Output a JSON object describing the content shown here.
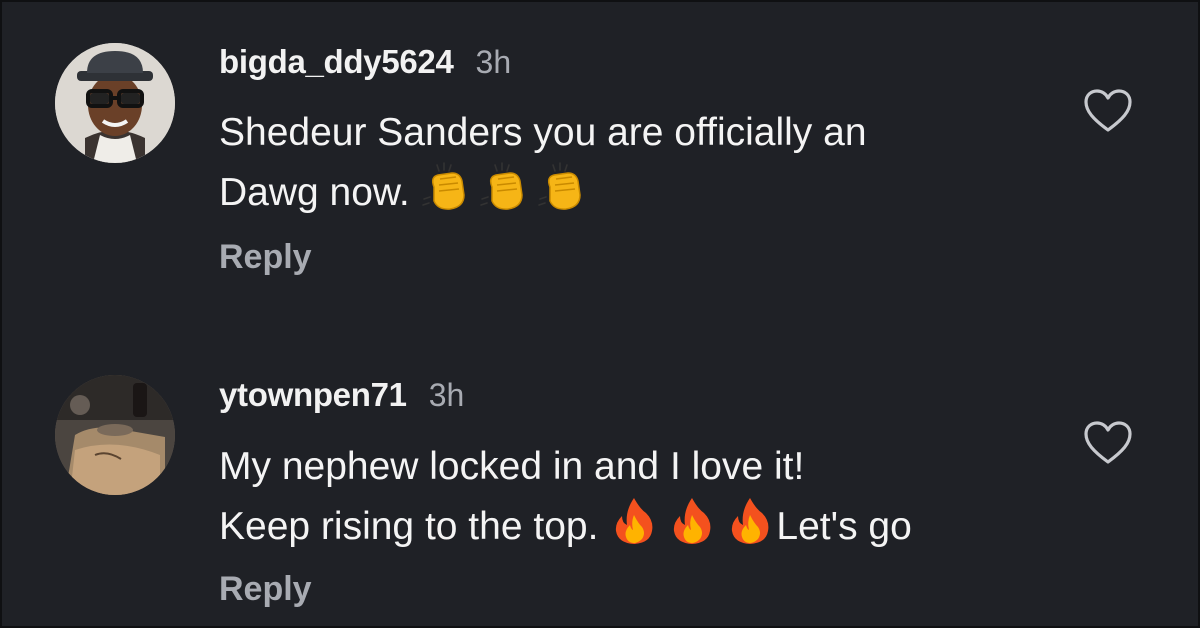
{
  "comments": [
    {
      "username": "bigda_ddy5624",
      "time": "3h",
      "text_line1": "Shedeur Sanders you are officially an",
      "text_line2": "Dawg now.",
      "emojis": [
        "clapping-hands",
        "clapping-hands",
        "clapping-hands"
      ],
      "reply_label": "Reply"
    },
    {
      "username": "ytownpen71",
      "time": "3h",
      "text_line1": "My nephew locked in and I love it!",
      "text_line2": "Keep rising to the top.",
      "emojis": [
        "fire",
        "fire",
        "fire"
      ],
      "text_after_emojis": "Let's go",
      "reply_label": "Reply"
    }
  ],
  "colors": {
    "background": "#1f2126",
    "username": "#f2f2f2",
    "secondary": "#a8abb2"
  }
}
